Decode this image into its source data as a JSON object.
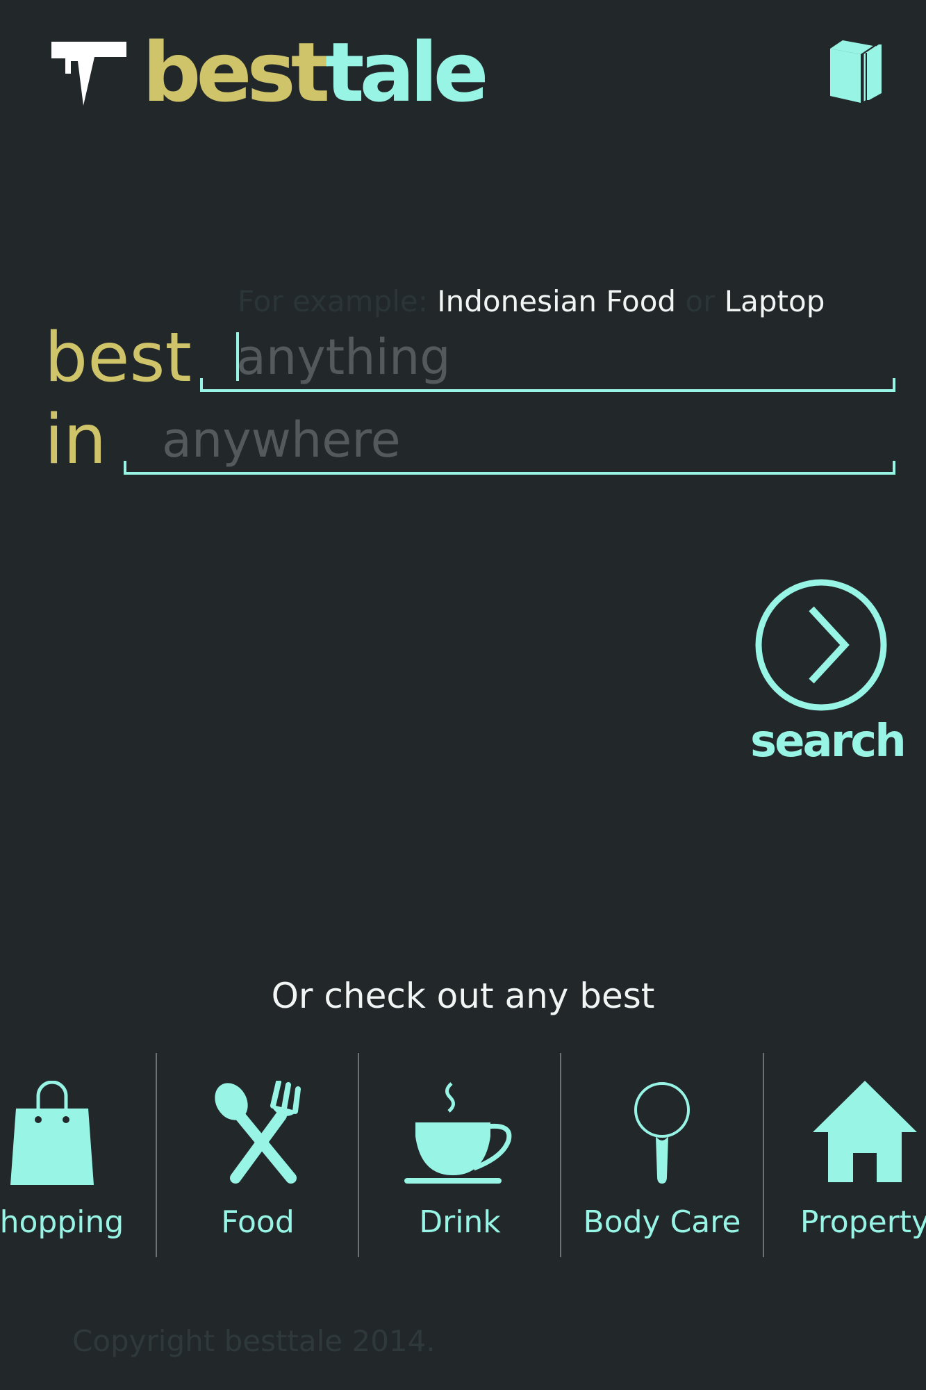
{
  "header": {
    "brand_part1": "best",
    "brand_part2": "tale",
    "logo_icon": "besttale-logo-icon",
    "menu_icon": "book-icon"
  },
  "search": {
    "example_prefix": "For example:",
    "example_1": "Indonesian Food",
    "example_sep": "or",
    "example_2": "Laptop",
    "label_what": "best",
    "placeholder_what": "anything",
    "label_where": "in",
    "placeholder_where": "anywhere",
    "submit_label": "search",
    "submit_icon": "chevron-right-circle-icon"
  },
  "categories": {
    "heading": "Or check out any best",
    "items": [
      {
        "label": "Shopping",
        "icon": "shopping-bag-icon"
      },
      {
        "label": "Food",
        "icon": "spoon-fork-icon"
      },
      {
        "label": "Drink",
        "icon": "coffee-cup-icon"
      },
      {
        "label": "Body Care",
        "icon": "hand-mirror-icon"
      },
      {
        "label": "Property",
        "icon": "house-icon"
      }
    ]
  },
  "footer": {
    "copyright": "Copyright besttale 2014."
  },
  "colors": {
    "background": "#22282a",
    "accent_cyan": "#98f5e6",
    "accent_gold": "#d0c46a",
    "text_light": "#f1f5f4",
    "placeholder": "#545a5c"
  }
}
